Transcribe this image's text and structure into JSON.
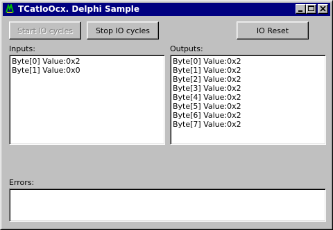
{
  "window": {
    "title": "TCatIoOcx. Delphi Sample"
  },
  "toolbar": {
    "start_label": "Start IO cycles",
    "stop_label": "Stop IO cycles",
    "reset_label": "IO Reset"
  },
  "inputs": {
    "label": "Inputs:",
    "items": [
      "Byte[0] Value:0x2",
      "Byte[1] Value:0x0"
    ]
  },
  "outputs": {
    "label": "Outputs:",
    "items": [
      "Byte[0] Value:0x2",
      "Byte[1] Value:0x2",
      "Byte[2] Value:0x2",
      "Byte[3] Value:0x2",
      "Byte[4] Value:0x2",
      "Byte[5] Value:0x2",
      "Byte[6] Value:0x2",
      "Byte[7] Value:0x2"
    ]
  },
  "errors": {
    "label": "Errors:",
    "items": []
  },
  "colors": {
    "titlebar": "#000080",
    "face": "#c0c0c0",
    "disabled_text": "#808080"
  }
}
